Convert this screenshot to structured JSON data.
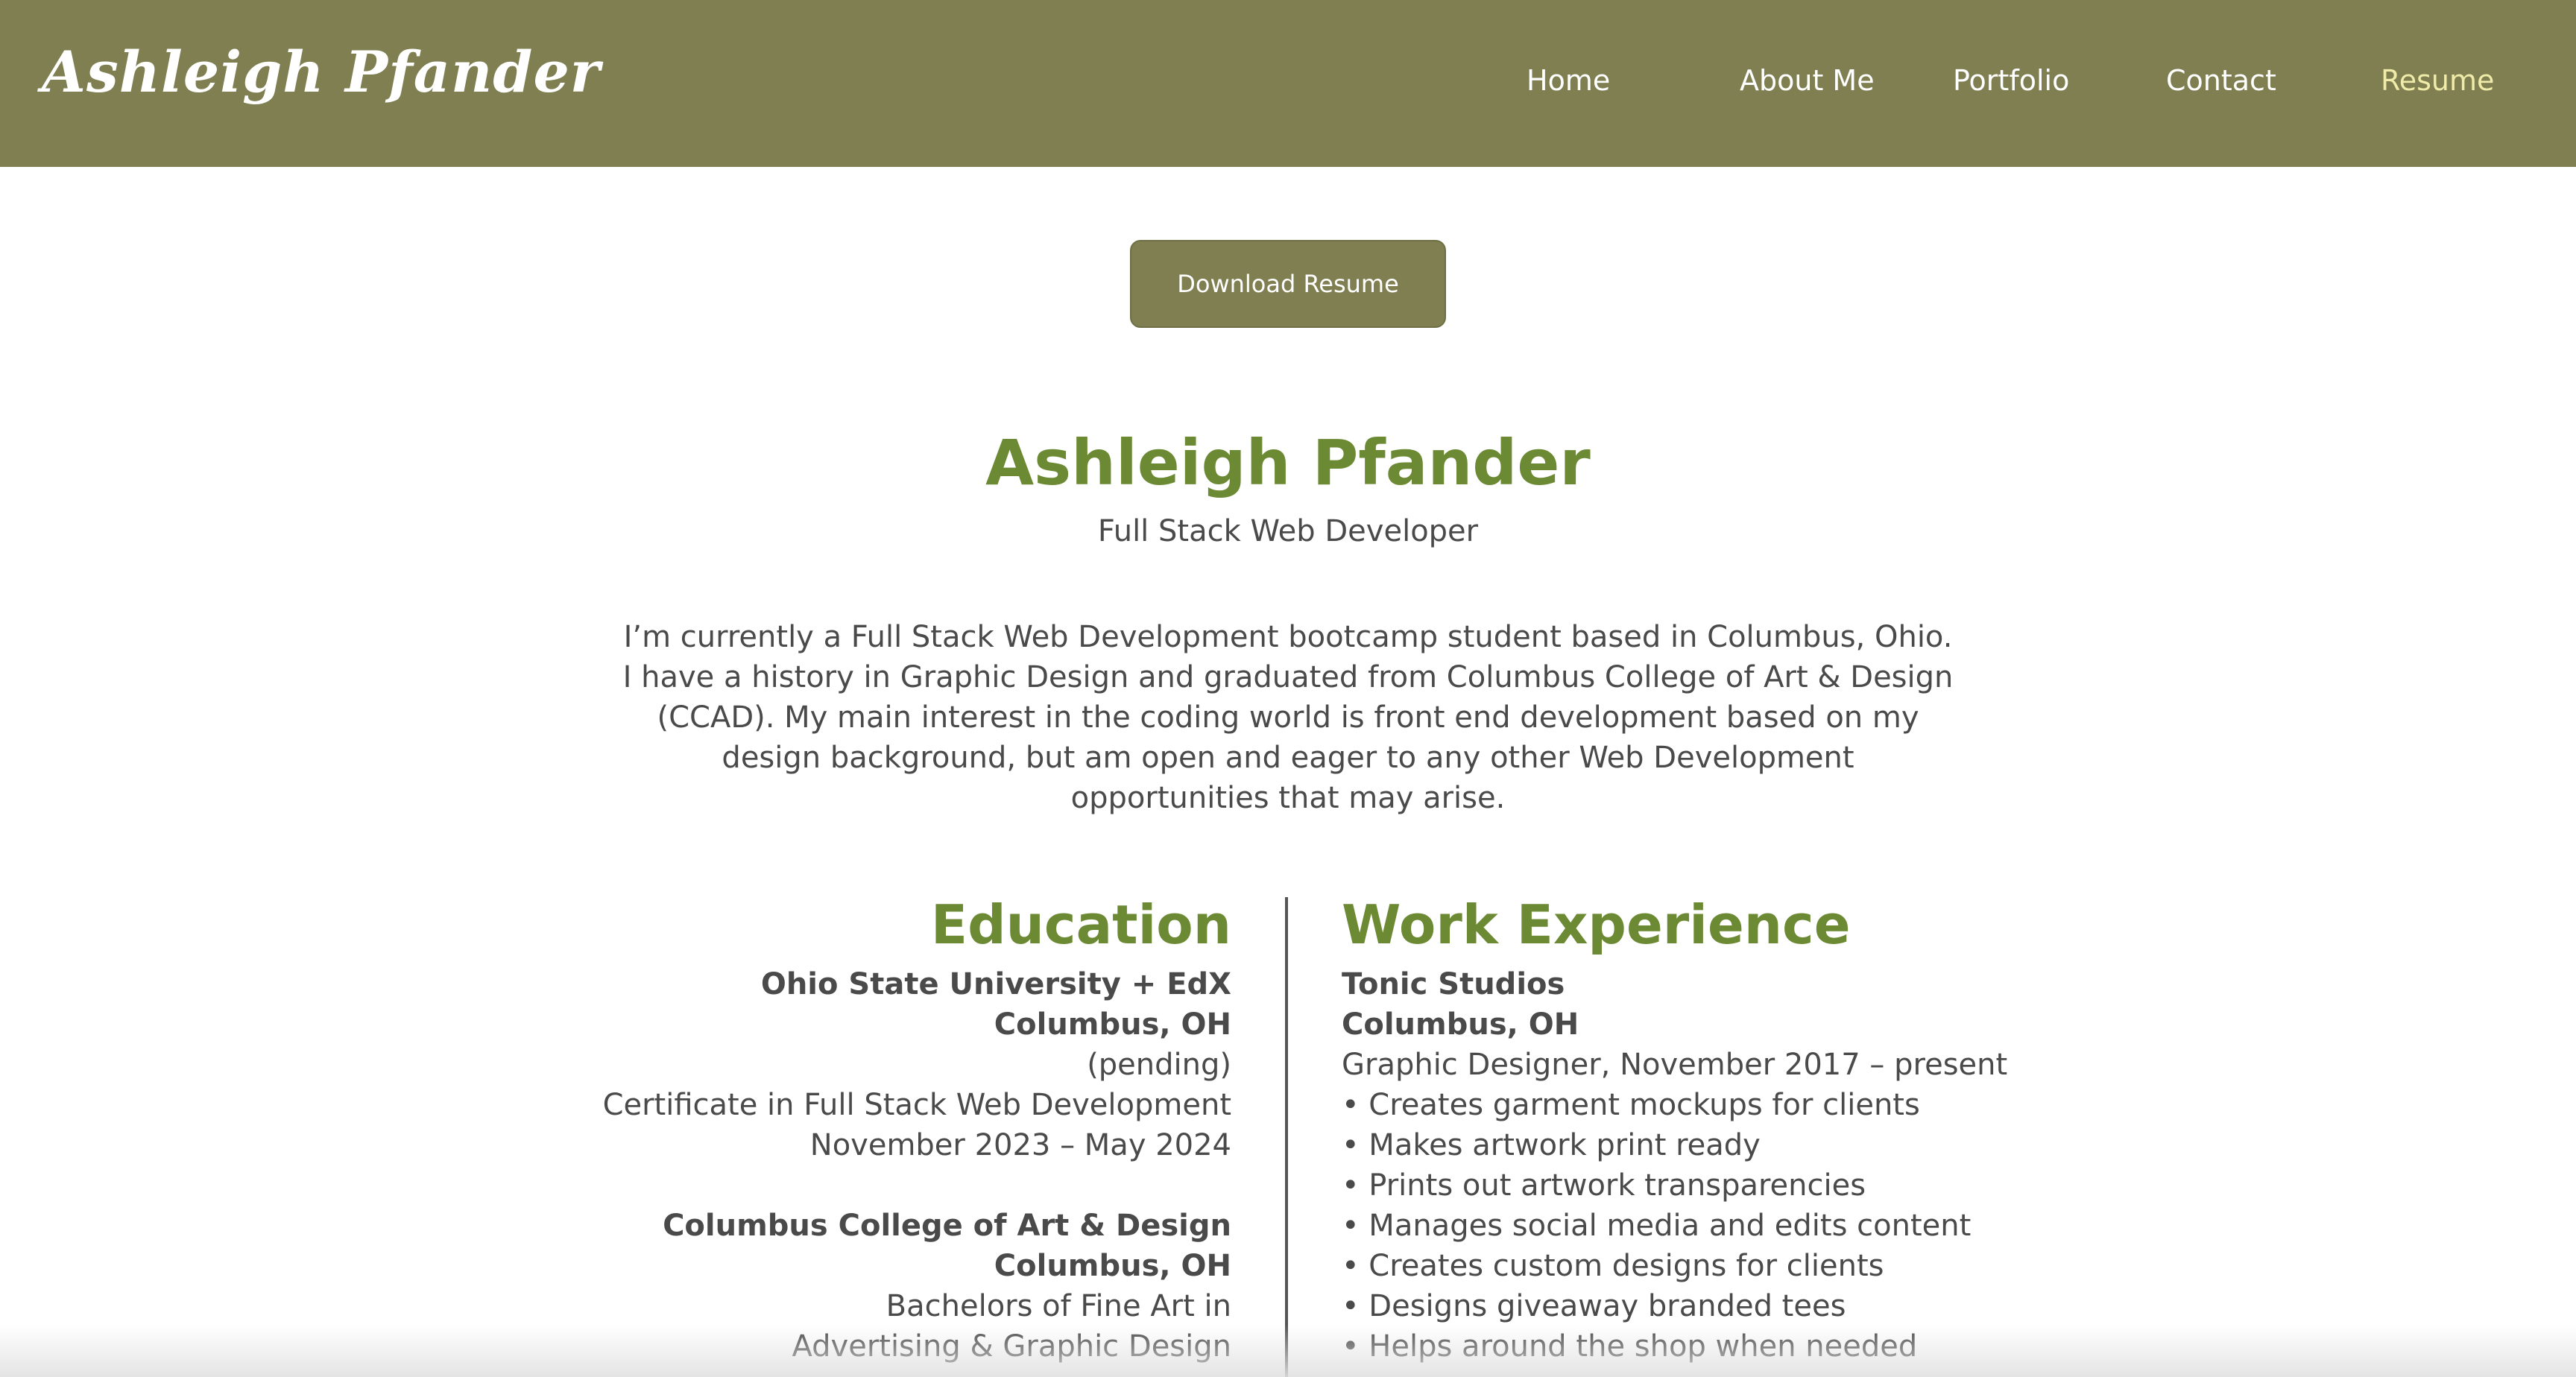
{
  "header": {
    "logo": "Ashleigh Pfander",
    "nav": [
      {
        "label": "Home"
      },
      {
        "label": "About Me"
      },
      {
        "label": "Portfolio"
      },
      {
        "label": "Contact"
      },
      {
        "label": "Resume"
      }
    ],
    "active_nav": "Resume"
  },
  "download_button": {
    "label": "Download Resume"
  },
  "resume": {
    "name": "Ashleigh Pfander",
    "title": "Full Stack Web Developer",
    "bio": [
      "I’m currently a Full Stack Web Development bootcamp student based in Columbus, Ohio.",
      "I have a history in Graphic Design and graduated from Columbus College of Art & Design",
      "(CCAD). My main interest in the coding world is front end development based on my",
      "design background, but am open and eager to any other Web Development",
      "opportunities that may arise."
    ],
    "education": {
      "heading": "Education",
      "entries": [
        {
          "school": "Ohio State University + EdX",
          "location": "Columbus, OH",
          "lines": [
            "(pending)",
            "Certificate in Full Stack Web Development",
            "November 2023 – May 2024"
          ]
        },
        {
          "school": "Columbus College of Art & Design",
          "location": "Columbus, OH",
          "lines": [
            "Bachelors of Fine Art in",
            "Advertising & Graphic Design"
          ]
        }
      ]
    },
    "work": {
      "heading": "Work Experience",
      "entries": [
        {
          "company": "Tonic Studios",
          "location": "Columbus, OH",
          "role": "Graphic Designer, November 2017 – present",
          "bullets": [
            "• Creates garment mockups for clients",
            "• Makes artwork print ready",
            "• Prints out artwork transparencies",
            "• Manages social media and edits content",
            "• Creates custom designs for clients",
            "• Designs giveaway branded tees",
            "• Helps around the shop when needed"
          ]
        }
      ]
    }
  },
  "colors": {
    "header_bg": "#7f7f52",
    "accent_green": "#6c8a34",
    "active_nav": "#f0eba8",
    "body_text": "#4a4a4a"
  }
}
